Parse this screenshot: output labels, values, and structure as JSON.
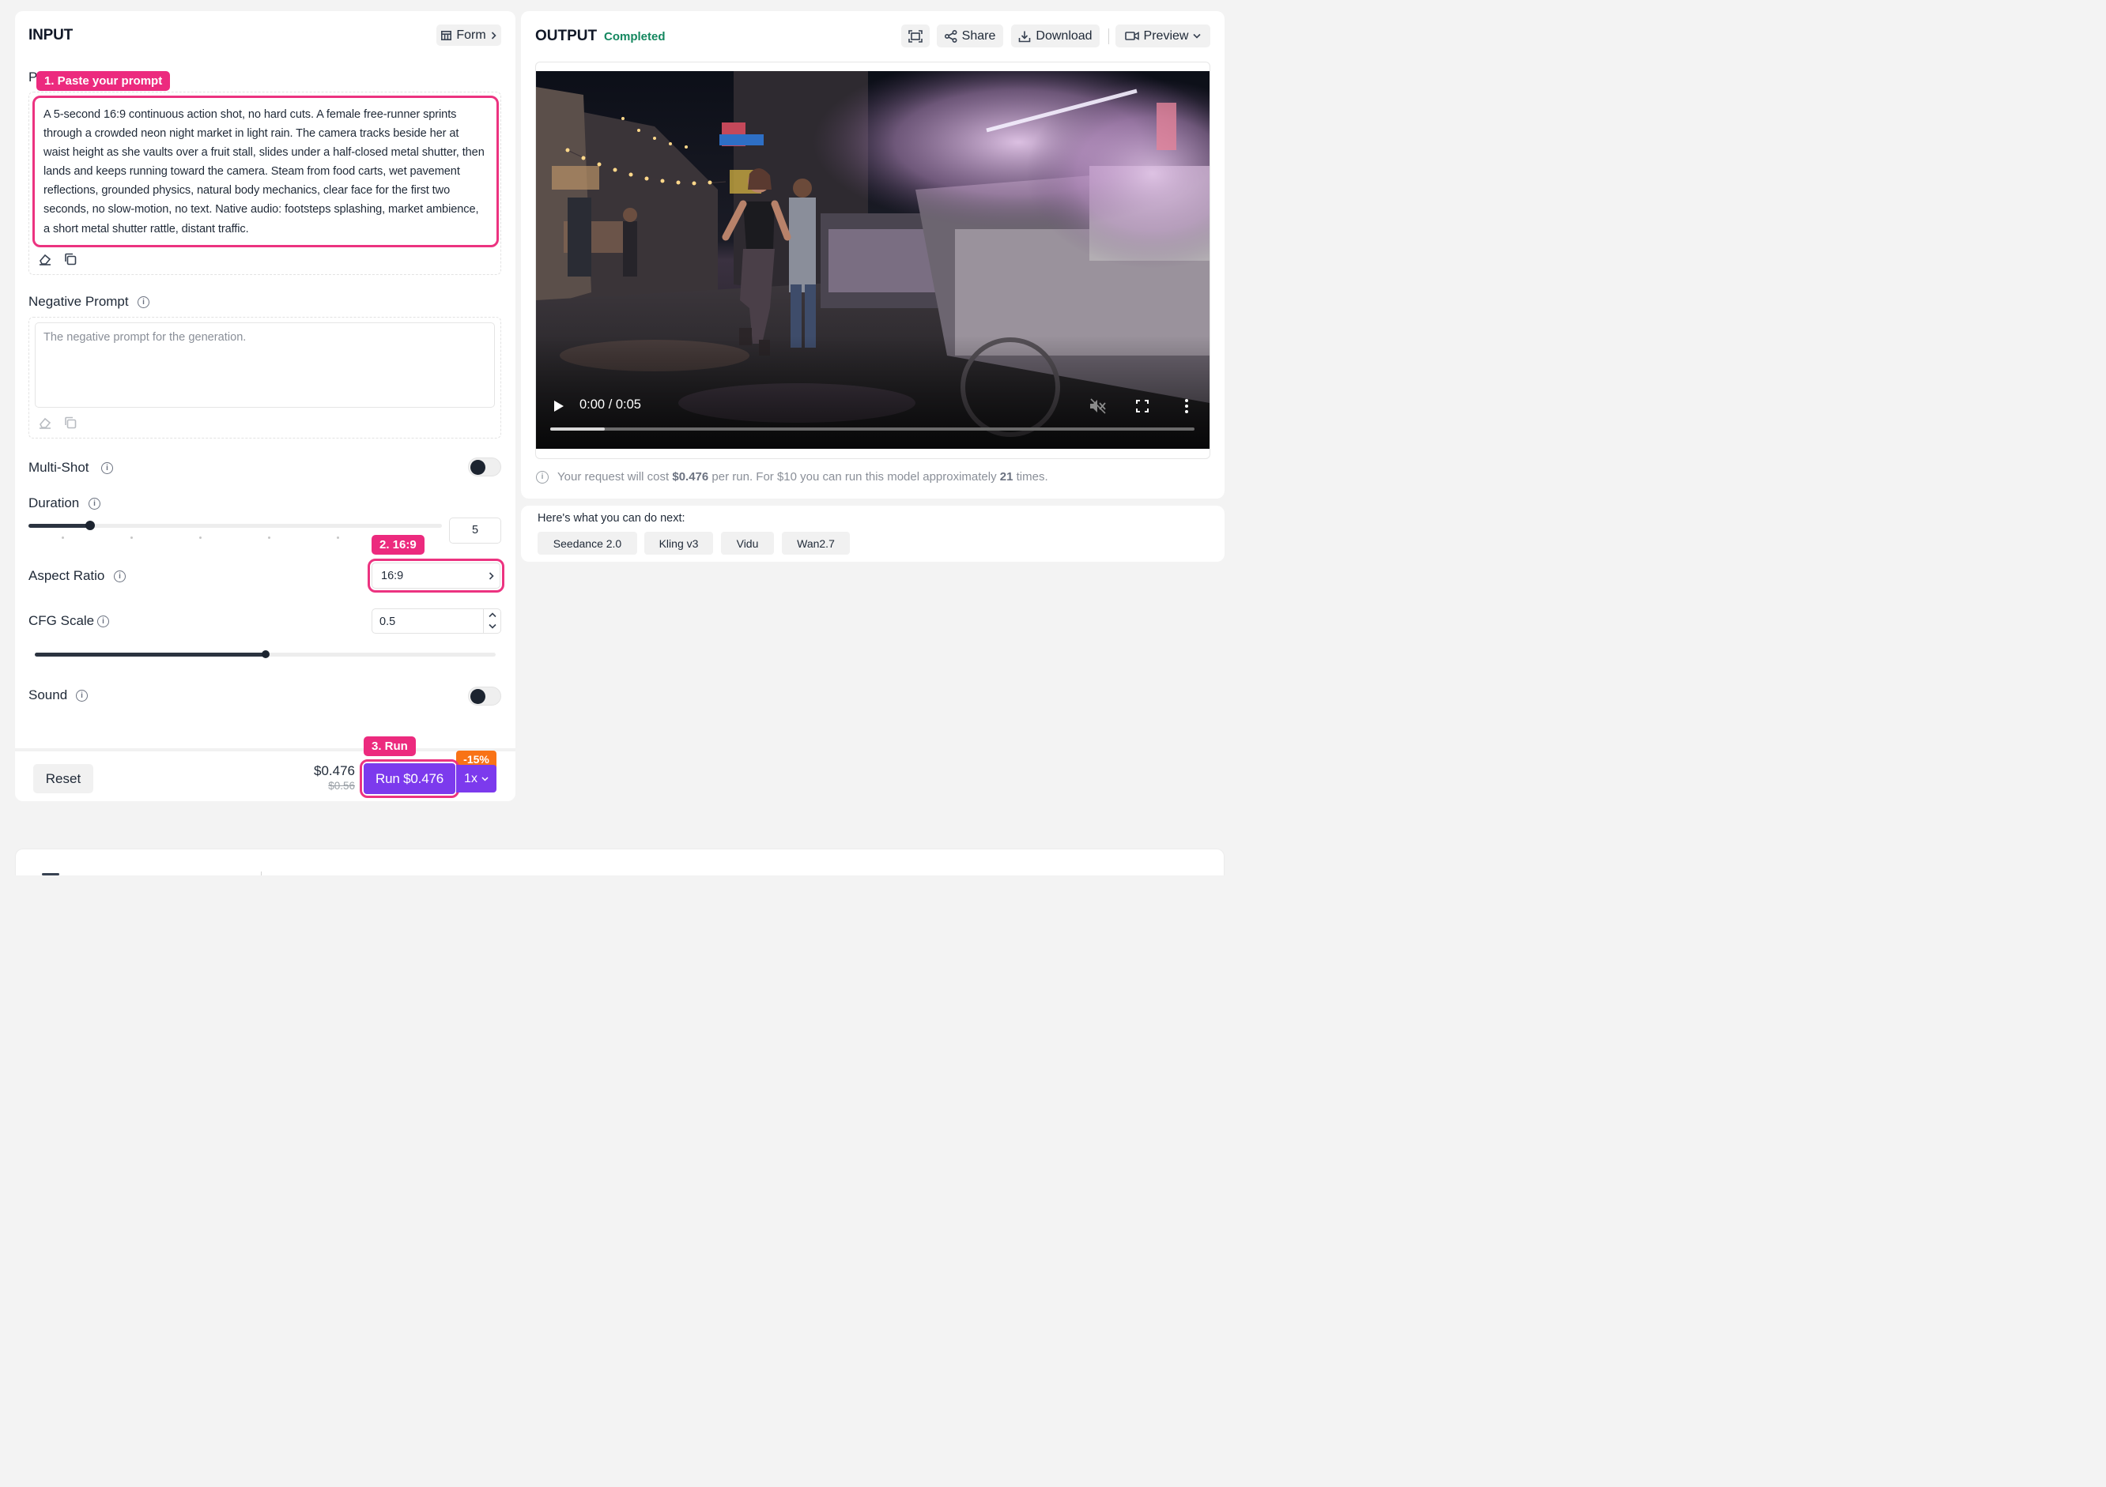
{
  "input": {
    "title": "INPUT",
    "form_button": "Form",
    "prompt_label_visible": "P",
    "prompt_value": "A 5-second 16:9 continuous action shot, no hard cuts. A female free-runner sprints through a crowded neon night market in light rain. The camera tracks beside her at waist height as she vaults over a fruit stall, slides under a half-closed metal shutter, then lands and keeps running toward the camera. Steam from food carts, wet pavement reflections, grounded physics, natural body mechanics, clear face for the first two seconds, no slow-motion, no text. Native audio: footsteps splashing, market ambience, a short metal shutter rattle, distant traffic.",
    "negative_prompt_label": "Negative Prompt",
    "negative_prompt_placeholder": "The negative prompt for the generation.",
    "multi_shot_label": "Multi-Shot",
    "multi_shot_on": false,
    "duration_label": "Duration",
    "duration_value": "5",
    "duration_fraction": 0.15,
    "aspect_ratio_label": "Aspect Ratio",
    "aspect_ratio_value": "16:9",
    "cfg_label": "CFG Scale",
    "cfg_value": "0.5",
    "cfg_fraction": 0.5,
    "sound_label": "Sound",
    "sound_on": false
  },
  "annotations": {
    "step1": "1. Paste your prompt",
    "step2": "2. 16:9",
    "step3": "3. Run"
  },
  "footer": {
    "reset": "Reset",
    "price": "$0.476",
    "old_price": "$0.56",
    "run_label": "Run $0.476",
    "discount": "-15%",
    "multiplier": "1x"
  },
  "output": {
    "title": "OUTPUT",
    "status": "Completed",
    "share": "Share",
    "download": "Download",
    "preview": "Preview",
    "video_time": "0:00 / 0:05",
    "video_progress": 0.085,
    "cost_prefix": "Your request will cost",
    "cost_value": "$0.476",
    "cost_mid": "per run. For $10 you can run this model approximately",
    "cost_runs": "21",
    "cost_suffix": "times."
  },
  "next": {
    "title": "Here's what you can do next:",
    "chips": [
      "Seedance 2.0",
      "Kling v3",
      "Vidu",
      "Wan2.7"
    ]
  },
  "colors": {
    "accent_purple": "#7c3aed",
    "annotation_pink": "#ec2a7e",
    "status_green": "#14875f",
    "discount_orange": "#f97316"
  }
}
